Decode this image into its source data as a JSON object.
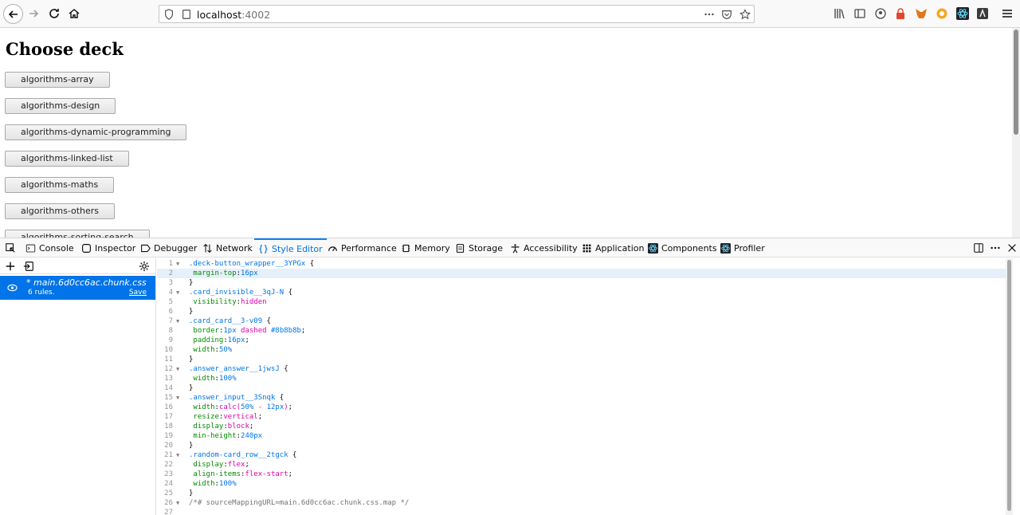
{
  "browser": {
    "url_host": "localhost",
    "url_port": ":4002"
  },
  "page": {
    "title": "Choose deck",
    "decks": [
      "algorithms-array",
      "algorithms-design",
      "algorithms-dynamic-programming",
      "algorithms-linked-list",
      "algorithms-maths",
      "algorithms-others",
      "algorithms-sorting-search"
    ]
  },
  "devtools": {
    "tabs": [
      {
        "label": "Console",
        "icon": "console-icon"
      },
      {
        "label": "Inspector",
        "icon": "inspector-icon"
      },
      {
        "label": "Debugger",
        "icon": "debugger-icon"
      },
      {
        "label": "Network",
        "icon": "network-icon"
      },
      {
        "label": "Style Editor",
        "icon": "style-editor-icon",
        "active": true
      },
      {
        "label": "Performance",
        "icon": "performance-icon"
      },
      {
        "label": "Memory",
        "icon": "memory-icon"
      },
      {
        "label": "Storage",
        "icon": "storage-icon"
      },
      {
        "label": "Accessibility",
        "icon": "accessibility-icon"
      },
      {
        "label": "Application",
        "icon": "application-icon"
      },
      {
        "label": "Components",
        "icon": "react-icon"
      },
      {
        "label": "Profiler",
        "icon": "react-icon"
      }
    ],
    "stylesheet": {
      "name": "* main.6d0cc6ac.chunk.css",
      "rules": "6 rules.",
      "save": "Save"
    },
    "code_lines": [
      ".deck-button_wrapper__3YPGx {",
      " margin-top:16px",
      "}",
      ".card_invisible__3qJ-N {",
      " visibility:hidden",
      "}",
      ".card_card__3-v09 {",
      " border:1px dashed #8b8b8b;",
      " padding:16px;",
      " width:50%",
      "}",
      ".answer_answer__1jwsJ {",
      " width:100%",
      "}",
      ".answer_input__3Snqk {",
      " width:calc(50% - 12px);",
      " resize:vertical;",
      " display:block;",
      " min-height:240px",
      "}",
      ".random-card_row__2tgck {",
      " display:flex;",
      " align-items:flex-start;",
      " width:100%",
      "}",
      "/*# sourceMappingURL=main.6d0cc6ac.chunk.css.map */",
      ""
    ],
    "highlighted_line": 2
  },
  "colors": {
    "accent": "#0a84ff",
    "selected_sheet_bg": "#0074e8",
    "selector": "#0074e8",
    "property": "#058b00",
    "value": "#dd00a9"
  }
}
